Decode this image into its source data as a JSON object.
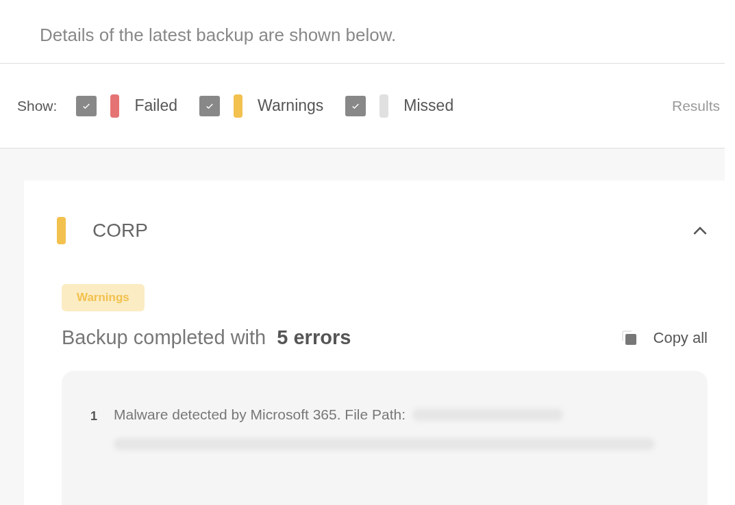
{
  "intro": "Details of the latest backup are shown below.",
  "filters": {
    "label": "Show:",
    "items": [
      {
        "label": "Failed",
        "checked": true,
        "color": "#e57373"
      },
      {
        "label": "Warnings",
        "checked": true,
        "color": "#f2c14e"
      },
      {
        "label": "Missed",
        "checked": true,
        "color": "#e0e0e0"
      }
    ],
    "results": "Results"
  },
  "card": {
    "title": "CORP",
    "color": "#f2c14e",
    "expanded": true,
    "badge": "Warnings",
    "summary": "Backup completed with **5 errors**",
    "copy": "Copy all",
    "errors": [
      {
        "number": "1",
        "text": "Malware detected by Microsoft 365. File Path:"
      }
    ]
  }
}
